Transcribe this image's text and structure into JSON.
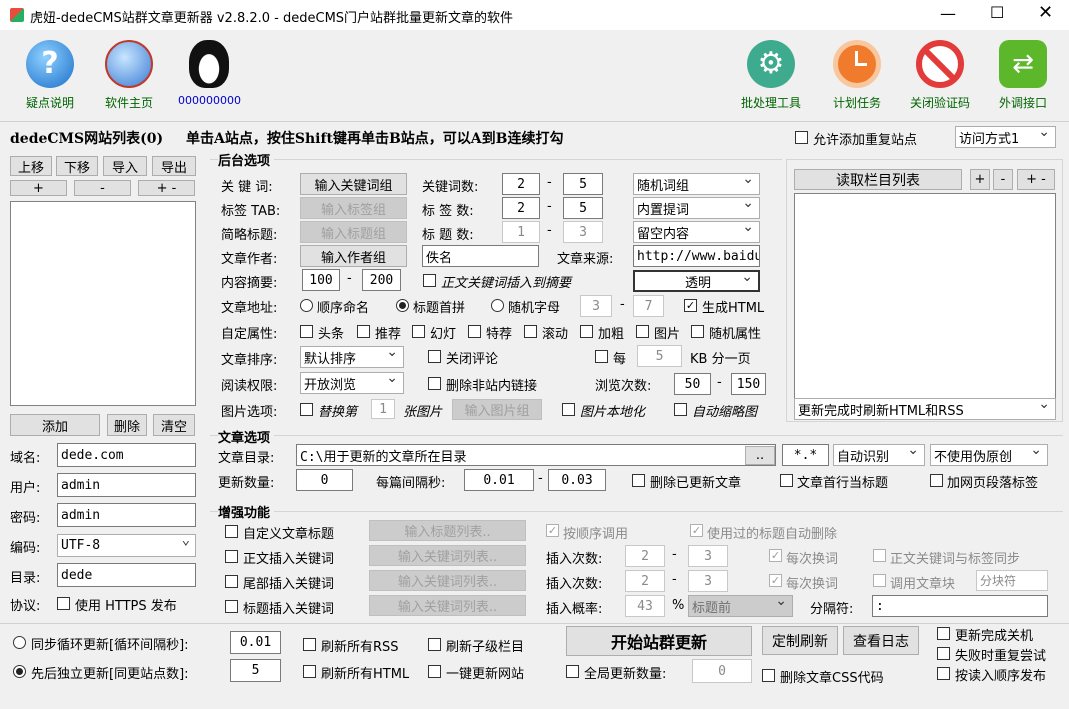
{
  "window": {
    "title": "虎妞-dedeCMS站群文章更新器 v2.8.2.0 - dedeCMS门户站群批量更新文章的软件"
  },
  "toolbar": {
    "left": [
      {
        "label": "疑点说明",
        "icon": "help-icon"
      },
      {
        "label": "软件主页",
        "icon": "globe-icon"
      },
      {
        "label": "000000000",
        "icon": "qq-penguin-icon"
      }
    ],
    "right": [
      {
        "label": "批处理工具",
        "icon": "gear-icon"
      },
      {
        "label": "计划任务",
        "icon": "clock-icon"
      },
      {
        "label": "关闭验证码",
        "icon": "no-entry-icon"
      },
      {
        "label": "外调接口",
        "icon": "swap-arrows-icon"
      }
    ]
  },
  "header": {
    "list_title": "dedeCMS网站列表(0)",
    "hint": "单击A站点，按住Shift键再单击B站点，可以A到B连续打勾",
    "allow_dup": "允许添加重复站点",
    "access_mode": "访问方式1"
  },
  "sites": {
    "btns": [
      "上移",
      "下移",
      "导入",
      "导出"
    ],
    "pm": [
      "+",
      "-",
      "+ -"
    ],
    "add": "添加",
    "del": "删除",
    "clear": "清空",
    "domain_label": "域名:",
    "domain": "dede.com",
    "user_label": "用户:",
    "user": "admin",
    "pass_label": "密码:",
    "pass": "admin",
    "enc_label": "编码:",
    "enc": "UTF-8",
    "dir_label": "目录:",
    "dir": "dede",
    "proto_label": "协议:",
    "https": "使用 HTTPS 发布"
  },
  "backend": {
    "title": "后台选项",
    "kw_label": "关 键 词:",
    "kw_btn": "输入关键词组",
    "tag_label": "标签 TAB:",
    "tag_btn": "输入标签组",
    "short_label": "简略标题:",
    "short_btn": "输入标题组",
    "author_label": "文章作者:",
    "author_btn": "输入作者组",
    "kwcount_label": "关键词数:",
    "kw_min": "2",
    "kw_max": "5",
    "kw_mode": "随机词组",
    "tagcount_label": "标 签 数:",
    "tag_min": "2",
    "tag_max": "5",
    "tag_mode": "内置提词",
    "titlecount_label": "标 题 数:",
    "title_min": "1",
    "title_max": "3",
    "title_mode": "留空内容",
    "author_val": "佚名",
    "source_label": "文章来源:",
    "source_val": "http://www.baidu",
    "summary_label": "内容摘要:",
    "sum_min": "100",
    "sum_max": "200",
    "kw_in_summary": "正文关键词插入到摘要",
    "transparent": "透明",
    "url_label": "文章地址:",
    "url_opts": [
      "顺序命名",
      "标题首拼",
      "随机字母"
    ],
    "rand_min": "3",
    "rand_max": "7",
    "gen_html": "生成HTML",
    "attr_label": "自定属性:",
    "attrs": [
      "头条",
      "推荐",
      "幻灯",
      "特荐",
      "滚动",
      "加粗",
      "图片",
      "随机属性"
    ],
    "sort_label": "文章排序:",
    "sort_val": "默认排序",
    "close_comment": "关闭评论",
    "per_label": "每",
    "per_val": "5",
    "per_unit": "KB 分一页",
    "read_label": "阅读权限:",
    "read_val": "开放浏览",
    "del_links": "删除非站内链接",
    "views_label": "浏览次数:",
    "views_min": "50",
    "views_max": "150",
    "img_label": "图片选项:",
    "img_replace": "替换第",
    "img_n": "1",
    "img_unit": "张图片",
    "img_btn": "输入图片组",
    "img_local": "图片本地化",
    "img_thumb": "自动缩略图"
  },
  "column": {
    "read_btn": "读取栏目列表",
    "pm": [
      "+",
      "-",
      "+ -"
    ],
    "refresh": "更新完成时刷新HTML和RSS"
  },
  "article": {
    "title": "文章选项",
    "dir_label": "文章目录:",
    "dir_val": "C:\\用于更新的文章所在目录",
    "browse": "..",
    "ext": "*.*",
    "detect": "自动识别",
    "pseudo": "不使用伪原创",
    "count_label": "更新数量:",
    "count_val": "0",
    "interval_label": "每篇间隔秒:",
    "int_min": "0.01",
    "int_max": "0.03",
    "del_updated": "删除已更新文章",
    "first_line": "文章首行当标题",
    "add_tags": "加网页段落标签"
  },
  "enhance": {
    "title": "增强功能",
    "rows": [
      {
        "check": "自定义文章标题",
        "btn": "输入标题列表.."
      },
      {
        "check": "正文插入关键词",
        "btn": "输入关键词列表.."
      },
      {
        "check": "尾部插入关键词",
        "btn": "输入关键词列表.."
      },
      {
        "check": "标题插入关键词",
        "btn": "输入关键词列表.."
      }
    ],
    "seq_call": "按顺序调用",
    "used_del": "使用过的标题自动删除",
    "ins_label": "插入次数:",
    "ins1_min": "2",
    "ins1_max": "3",
    "ins2_min": "2",
    "ins2_max": "3",
    "each_change": "每次换词",
    "kw_tag_sync": "正文关键词与标签同步",
    "call_block": "调用文章块",
    "block_sep": "分块符",
    "prob_label": "插入概率:",
    "prob_val": "43",
    "prob_unit": "%",
    "prob_pos": "标题前",
    "sep_label": "分隔符:",
    "sep_val": ":"
  },
  "bottom": {
    "sync_loop": "同步循环更新[循环间隔秒]:",
    "sync_val": "0.01",
    "seq_indep": "先后独立更新[同更站点数]:",
    "seq_val": "5",
    "refresh_rss": "刷新所有RSS",
    "refresh_sub": "刷新子级栏目",
    "refresh_html": "刷新所有HTML",
    "one_click": "一键更新网站",
    "start": "开始站群更新",
    "custom_refresh": "定制刷新",
    "view_log": "查看日志",
    "global_count": "全局更新数量:",
    "global_val": "0",
    "del_css": "删除文章CSS代码",
    "shutdown": "更新完成关机",
    "retry": "失败时重复尝试",
    "read_order": "按读入顺序发布"
  },
  "colors": {
    "bg": "#f0f0f0",
    "gear": "#3eab8f",
    "clock": "#f07b2c",
    "noentry": "#e33a3a",
    "swap": "#5cb82a"
  }
}
